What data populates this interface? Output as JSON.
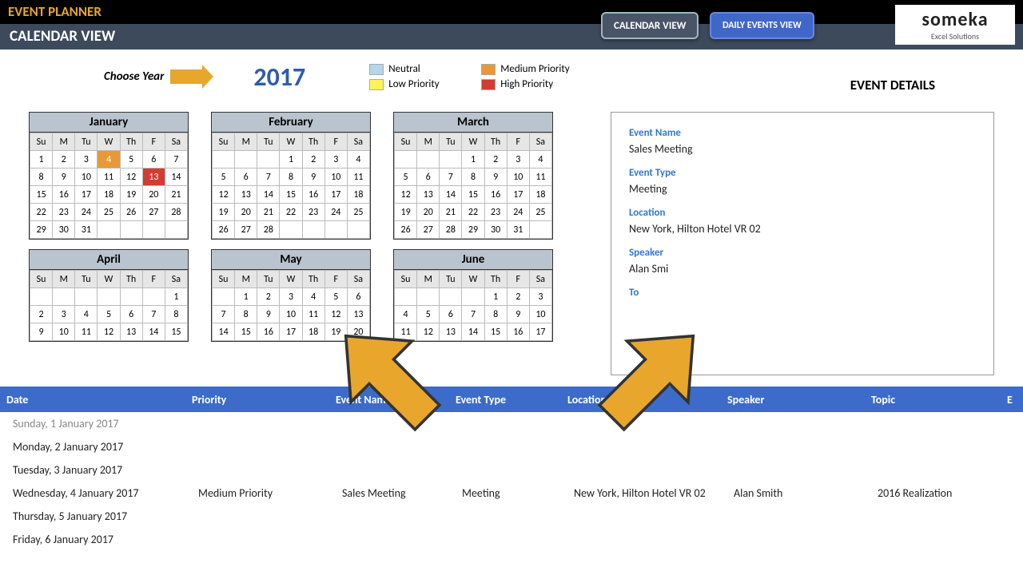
{
  "header": {
    "title": "EVENT PLANNER",
    "subtitle": "CALENDAR VIEW",
    "nav_a": "CALENDAR VIEW",
    "nav_b": "DAILY EVENTS VIEW",
    "logo_big": "someka",
    "logo_small": "Excel Solutions"
  },
  "controls": {
    "choose_label": "Choose Year",
    "year": "2017",
    "legend": {
      "neutral": "Neutral",
      "low": "Low Priority",
      "medium": "Medium Priority",
      "high": "High Priority"
    }
  },
  "details_title": "EVENT DETAILS",
  "details": {
    "name_label": "Event Name",
    "name": "Sales Meeting",
    "type_label": "Event Type",
    "type": "Meeting",
    "loc_label": "Location",
    "loc": "New York, Hilton Hotel VR 02",
    "spk_label": "Speaker",
    "spk": "Alan Smi",
    "topic_label": "To"
  },
  "dow": [
    "Su",
    "M",
    "Tu",
    "W",
    "Th",
    "F",
    "Sa"
  ],
  "months": [
    {
      "name": "January",
      "lead": 0,
      "days": 31,
      "highlights": {
        "4": "med",
        "13": "high"
      }
    },
    {
      "name": "February",
      "lead": 3,
      "days": 28,
      "highlights": {}
    },
    {
      "name": "March",
      "lead": 3,
      "days": 31,
      "highlights": {}
    },
    {
      "name": "April",
      "lead": 6,
      "days": 30,
      "highlights": {},
      "rows": 3
    },
    {
      "name": "May",
      "lead": 1,
      "days": 31,
      "highlights": {},
      "rows": 3
    },
    {
      "name": "June",
      "lead": 4,
      "days": 30,
      "highlights": {},
      "rows": 3
    }
  ],
  "table": {
    "headers": {
      "date": "Date",
      "priority": "Priority",
      "name": "Event Name",
      "type": "Event Type",
      "loc": "Location",
      "spk": "Speaker",
      "topic": "Topic",
      "extra": "E"
    },
    "rows": [
      {
        "date": "Sunday, 1 January 2017",
        "gray": true
      },
      {
        "date": "Monday, 2 January 2017"
      },
      {
        "date": "Tuesday, 3 January 2017"
      },
      {
        "date": "Wednesday, 4 January 2017",
        "priority": "Medium Priority",
        "name": "Sales Meeting",
        "type": "Meeting",
        "loc": "New York, Hilton Hotel VR 02",
        "spk": "Alan Smith",
        "topic": "2016 Realization"
      },
      {
        "date": "Thursday, 5 January 2017"
      },
      {
        "date": "Friday, 6 January 2017"
      }
    ]
  }
}
